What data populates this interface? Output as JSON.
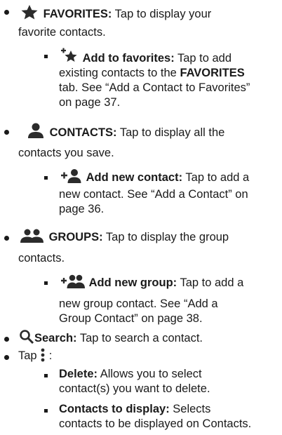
{
  "items": [
    {
      "term": "FAVORITES:",
      "desc1": " Tap to display your",
      "desc2": "favorite contacts."
    },
    {
      "term": "Add to favorites:",
      "desc1": " Tap to add",
      "desc2a": "existing contacts to the ",
      "desc2b": "FAVORITES",
      "desc3": "tab. See “Add a Contact to Favorites”",
      "desc4": "on page 37."
    },
    {
      "term": "CONTACTS:",
      "desc1": " Tap to display all the",
      "desc2": "contacts you save."
    },
    {
      "term": "Add new contact:",
      "desc1": " Tap to add a",
      "desc2": "new contact. See “Add a Contact” on",
      "desc3": "page 36."
    },
    {
      "term": "GROUPS:",
      "desc1": " Tap to display the group",
      "desc2": "contacts."
    },
    {
      "term": "Add new group:",
      "desc1": " Tap to add a",
      "desc2": "new group contact. See “Add a",
      "desc3": "Group Contact” on page 38."
    },
    {
      "term": "Search:",
      "desc1": " Tap to search a contact."
    },
    {
      "text1": "Tap ",
      "text2": " :"
    },
    {
      "term": "Delete:",
      "desc1": " Allows you to select",
      "desc2": "contact(s) you want to delete."
    },
    {
      "term": "Contacts to display:",
      "desc1": " Selects",
      "desc2": "contacts to be displayed on Contacts."
    }
  ],
  "icons": [
    "star-icon",
    "add-star-icon",
    "person-icon",
    "add-person-icon",
    "group-icon",
    "add-group-icon",
    "search-icon",
    "more-vert-icon"
  ]
}
